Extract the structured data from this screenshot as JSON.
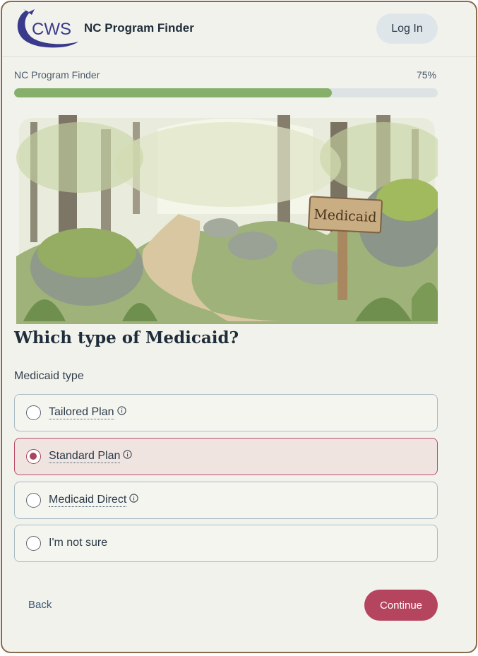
{
  "header": {
    "logo_text": "CWS",
    "app_title": "NC Program Finder",
    "login_label": "Log In"
  },
  "progress": {
    "label": "NC Program Finder",
    "percent_label": "75%",
    "fraction": 0.75
  },
  "hero": {
    "sign_text": "Medicaid"
  },
  "question": {
    "title": "Which type of Medicaid?",
    "field_label": "Medicaid type",
    "options": [
      {
        "label": "Tailored Plan",
        "has_info": true,
        "selected": false
      },
      {
        "label": "Standard Plan",
        "has_info": true,
        "selected": true
      },
      {
        "label": "Medicaid Direct",
        "has_info": true,
        "selected": false
      },
      {
        "label": "I'm not sure",
        "has_info": false,
        "selected": false
      }
    ]
  },
  "footer": {
    "back_label": "Back",
    "continue_label": "Continue"
  },
  "colors": {
    "accent": "#b5455f",
    "progress": "#86b06a",
    "logo": "#3a3a8c"
  }
}
